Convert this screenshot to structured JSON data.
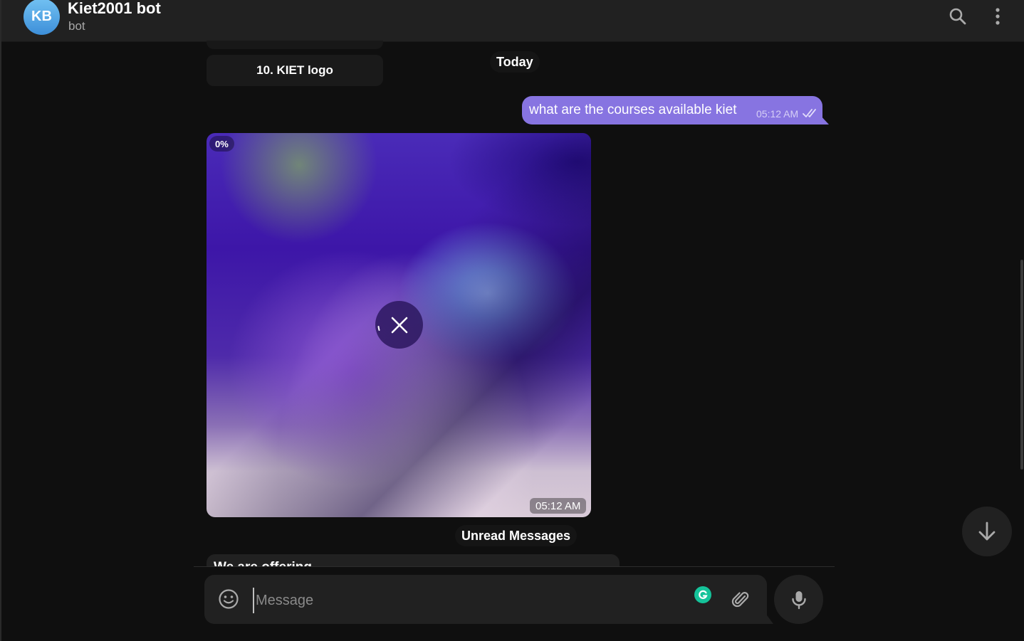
{
  "header": {
    "avatar_initials": "KB",
    "title": "Kiet2001 bot",
    "status": "bot",
    "search_icon": "search-icon",
    "menu_icon": "more-vertical-icon"
  },
  "messages": {
    "previous_button_label": "10. KIET logo",
    "date_separator": "Today",
    "outgoing": {
      "text": "what are the courses available kiet",
      "time": "05:12 AM",
      "status_icon": "double-check-icon"
    },
    "media": {
      "progress": "0%",
      "time": "05:12 AM",
      "cancel_icon": "close-icon"
    },
    "unread_separator": "Unread Messages",
    "next_message_text": "We are offering"
  },
  "composer": {
    "placeholder": "Message",
    "emoji_icon": "smile-icon",
    "grammarly_icon": "grammarly-icon",
    "attach_icon": "paperclip-icon",
    "mic_icon": "microphone-icon"
  },
  "scroll_down_icon": "arrow-down-icon",
  "colors": {
    "outgoing_bubble": "#8774e1",
    "background": "#0f0f0f",
    "panel": "#212121",
    "avatar": "#5aa8ea",
    "grammarly": "#15c39a"
  }
}
